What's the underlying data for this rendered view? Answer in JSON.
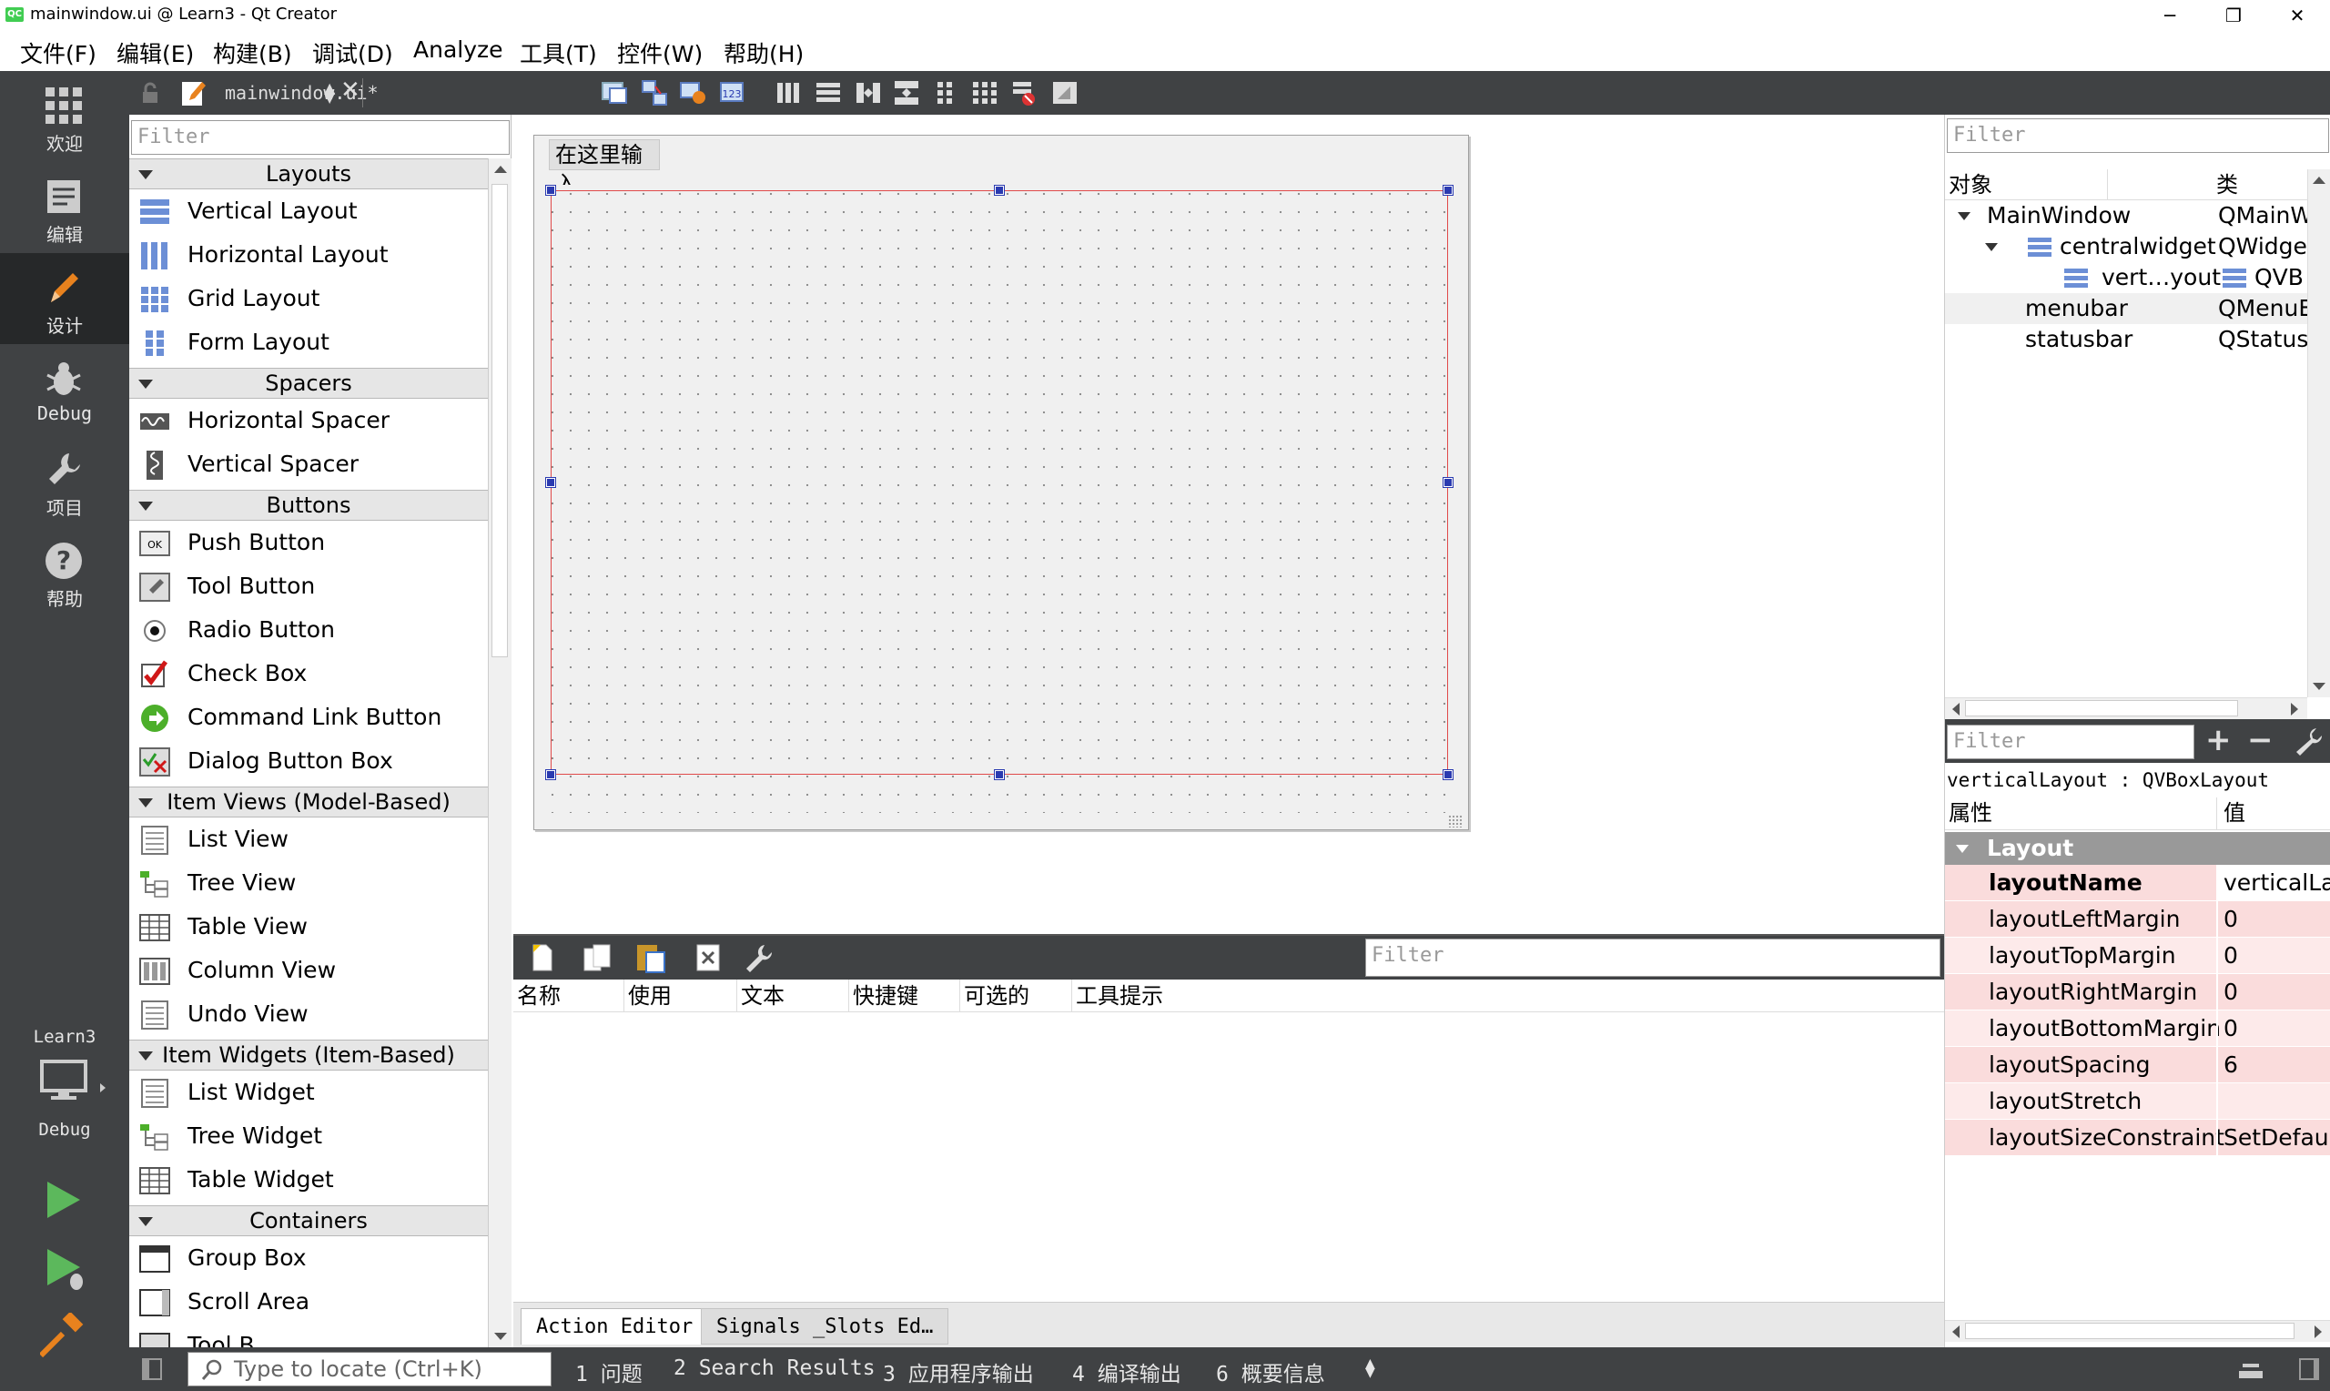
{
  "window": {
    "title": "mainwindow.ui @ Learn3 - Qt Creator",
    "minimize": "─",
    "maximize": "❐",
    "close": "✕"
  },
  "menubar": [
    "文件(F)",
    "编辑(E)",
    "构建(B)",
    "调试(D)",
    "Analyze",
    "工具(T)",
    "控件(W)",
    "帮助(H)"
  ],
  "modes": [
    "欢迎",
    "编辑",
    "设计",
    "Debug",
    "项目",
    "帮助"
  ],
  "active_mode": "设计",
  "kit": {
    "project": "Learn3",
    "config": "Debug"
  },
  "editor": {
    "file": "mainwindow.ui*"
  },
  "widget_box": {
    "filter_placeholder": "Filter",
    "categories": [
      {
        "name": "Layouts",
        "items": [
          "Vertical Layout",
          "Horizontal Layout",
          "Grid Layout",
          "Form Layout"
        ]
      },
      {
        "name": "Spacers",
        "items": [
          "Horizontal Spacer",
          "Vertical Spacer"
        ]
      },
      {
        "name": "Buttons",
        "items": [
          "Push Button",
          "Tool Button",
          "Radio Button",
          "Check Box",
          "Command Link Button",
          "Dialog Button Box"
        ]
      },
      {
        "name": "Item Views (Model-Based)",
        "items": [
          "List View",
          "Tree View",
          "Table View",
          "Column View",
          "Undo View"
        ]
      },
      {
        "name": "Item Widgets (Item-Based)",
        "items": [
          "List Widget",
          "Tree Widget",
          "Table Widget"
        ]
      },
      {
        "name": "Containers",
        "items": [
          "Group Box",
          "Scroll Area",
          "Tool B..."
        ]
      }
    ]
  },
  "form": {
    "menu_placeholder": "在这里输入"
  },
  "action_editor": {
    "filter_placeholder": "Filter",
    "columns": [
      "名称",
      "使用",
      "文本",
      "快捷键",
      "可选的",
      "工具提示"
    ],
    "tabs": [
      "Action Editor",
      "Signals _Slots Ed…"
    ]
  },
  "object_inspector": {
    "filter_placeholder": "Filter",
    "columns": [
      "对象",
      "类"
    ],
    "rows": [
      {
        "name": "MainWindow",
        "class": "QMainW"
      },
      {
        "name": "centralwidget",
        "class": "QWidge"
      },
      {
        "name": "vert…yout",
        "class": "QVB"
      },
      {
        "name": "menubar",
        "class": "QMenuE"
      },
      {
        "name": "statusbar",
        "class": "QStatusI"
      }
    ]
  },
  "property_editor": {
    "filter_placeholder": "Filter",
    "object_label": "verticalLayout : QVBoxLayout",
    "columns": [
      "属性",
      "值"
    ],
    "section": "Layout",
    "properties": [
      {
        "name": "layoutName",
        "value": "verticalLay"
      },
      {
        "name": "layoutLeftMargin",
        "value": "0"
      },
      {
        "name": "layoutTopMargin",
        "value": "0"
      },
      {
        "name": "layoutRightMargin",
        "value": "0"
      },
      {
        "name": "layoutBottomMargin",
        "value": "0"
      },
      {
        "name": "layoutSpacing",
        "value": "6"
      },
      {
        "name": "layoutStretch",
        "value": ""
      },
      {
        "name": "layoutSizeConstraint",
        "value": "SetDefault"
      }
    ]
  },
  "statusbar": {
    "locator_placeholder": "Type to locate (Ctrl+K)",
    "panes": [
      "1  问题",
      "2  Search Results",
      "3  应用程序输出",
      "4  编译输出",
      "6  概要信息"
    ]
  },
  "colors": {
    "sidebar": "#404244",
    "active_mode": "#262829",
    "property_highlight": "#fadcdc",
    "layout_border": "#e04a4a",
    "handle": "#2a3ab0"
  }
}
